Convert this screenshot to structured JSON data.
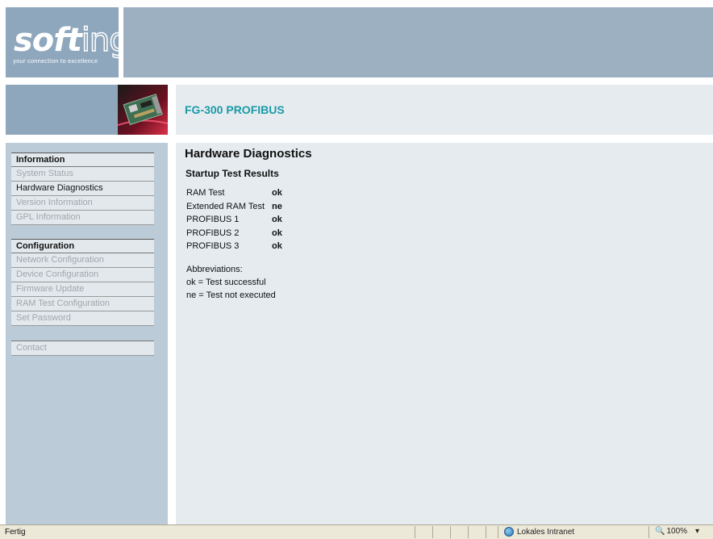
{
  "brand": {
    "logo_text": "softing",
    "tagline": "your connection to excellence"
  },
  "product": {
    "title": "FG-300 PROFIBUS"
  },
  "page": {
    "title": "Hardware Diagnostics",
    "subtitle": "Startup Test Results"
  },
  "results": [
    {
      "name": "RAM Test",
      "value": "ok"
    },
    {
      "name": "Extended RAM Test",
      "value": "ne"
    },
    {
      "name": "PROFIBUS 1",
      "value": "ok"
    },
    {
      "name": "PROFIBUS 2",
      "value": "ok"
    },
    {
      "name": "PROFIBUS 3",
      "value": "ok"
    }
  ],
  "abbreviations": {
    "heading": "Abbreviations:",
    "ok": "ok = Test successful",
    "ne": "ne = Test not executed"
  },
  "menu": {
    "information": {
      "heading": "Information",
      "items": [
        "System Status",
        "Hardware Diagnostics",
        "Version Information",
        "GPL Information"
      ]
    },
    "configuration": {
      "heading": "Configuration",
      "items": [
        "Network Configuration",
        "Device Configuration",
        "Firmware Update",
        "RAM Test Configuration",
        "Set Password"
      ]
    },
    "contact": "Contact"
  },
  "statusbar": {
    "left": "Fertig",
    "zone": "Lokales Intranet",
    "zoom": "100%"
  },
  "colors": {
    "accent": "#1a9aa6",
    "header": "#9db0c2",
    "logo_bg": "#8fa7bd",
    "sidebar": "#bccbd8",
    "main_bg": "#e5ebef"
  }
}
